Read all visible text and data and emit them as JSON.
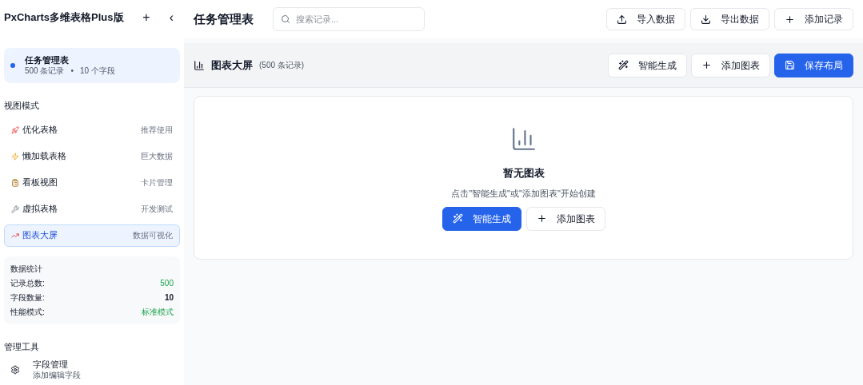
{
  "sidebar": {
    "app_title": "PxCharts多维表格Plus版",
    "add_label": "+",
    "collapse_label": "‹",
    "table": {
      "name": "任务管理表",
      "records": "500 条记录",
      "separator": "•",
      "fields": "10 个字段",
      "selected": true
    },
    "view_section_title": "视图模式",
    "views": [
      {
        "label": "优化表格",
        "hint": "推荐使用",
        "selected": false
      },
      {
        "label": "懒加载表格",
        "hint": "巨大数据",
        "selected": false
      },
      {
        "label": "看板视图",
        "hint": "卡片管理",
        "selected": false
      },
      {
        "label": "虚拟表格",
        "hint": "开发测试",
        "selected": false
      },
      {
        "label": "图表大屏",
        "hint": "数据可视化",
        "selected": true
      }
    ],
    "stats": {
      "title": "数据统计",
      "rows": [
        {
          "label": "记录总数:",
          "value": "500",
          "kind": "positive"
        },
        {
          "label": "字段数量:",
          "value": "10",
          "kind": "neutral"
        },
        {
          "label": "性能模式:",
          "value": "标准模式",
          "kind": "positive"
        }
      ]
    },
    "tools_section_title": "管理工具",
    "tools": [
      {
        "label": "字段管理",
        "hint": "添加编辑字段"
      }
    ]
  },
  "topbar": {
    "title": "任务管理表",
    "search": {
      "placeholder": "搜索记录..."
    },
    "buttons": [
      {
        "label": "导入数据",
        "kind": "upload"
      },
      {
        "label": "导出数据",
        "kind": "download"
      },
      {
        "label": "添加记录",
        "kind": "plus"
      }
    ]
  },
  "subheader": {
    "title": "图表大屏",
    "count": "(500 条记录)",
    "buttons": [
      {
        "label": "智能生成",
        "kind": "wand",
        "primary": false
      },
      {
        "label": "添加图表",
        "kind": "plus",
        "primary": false
      },
      {
        "label": "保存布局",
        "kind": "save",
        "primary": true
      }
    ]
  },
  "empty_state": {
    "title": "暂无图表",
    "message": "点击\"智能生成\"或\"添加图表\"开始创建",
    "buttons": [
      {
        "label": "智能生成",
        "kind": "wand",
        "primary": true
      },
      {
        "label": "添加图表",
        "kind": "plus",
        "primary": false
      }
    ]
  }
}
